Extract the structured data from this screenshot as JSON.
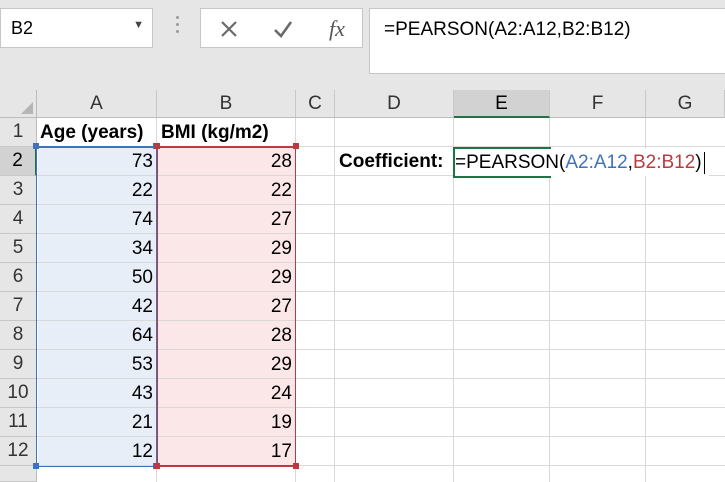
{
  "name_box": {
    "value": "B2",
    "dropdown_glyph": "▼"
  },
  "formula_bar": {
    "cancel_icon": "close-icon",
    "enter_icon": "check-icon",
    "insert_function_label": "fx",
    "formula": "=PEARSON(A2:A12,B2:B12)"
  },
  "columns": [
    "A",
    "B",
    "C",
    "D",
    "E",
    "F",
    "G"
  ],
  "selected_column": "E",
  "rows": [
    "1",
    "2",
    "3",
    "4",
    "5",
    "6",
    "7",
    "8",
    "9",
    "10",
    "11",
    "12"
  ],
  "selected_row": "2",
  "headers": {
    "a1": "Age (years)",
    "b1": "BMI (kg/m2)"
  },
  "data": [
    {
      "age": "73",
      "bmi": "28"
    },
    {
      "age": "22",
      "bmi": "22"
    },
    {
      "age": "74",
      "bmi": "27"
    },
    {
      "age": "34",
      "bmi": "29"
    },
    {
      "age": "50",
      "bmi": "29"
    },
    {
      "age": "42",
      "bmi": "27"
    },
    {
      "age": "64",
      "bmi": "28"
    },
    {
      "age": "53",
      "bmi": "29"
    },
    {
      "age": "43",
      "bmi": "24"
    },
    {
      "age": "21",
      "bmi": "19"
    },
    {
      "age": "12",
      "bmi": "17"
    }
  ],
  "label_d2": "Coefficient:",
  "editing_cell": {
    "prefix": "=PEARSON(",
    "range_a": "A2:A12",
    "separator": ",",
    "range_b": "B2:B12",
    "suffix": ")"
  },
  "colors": {
    "accent": "#217346",
    "range_a": "#3f72b8",
    "range_b": "#b83b42"
  }
}
